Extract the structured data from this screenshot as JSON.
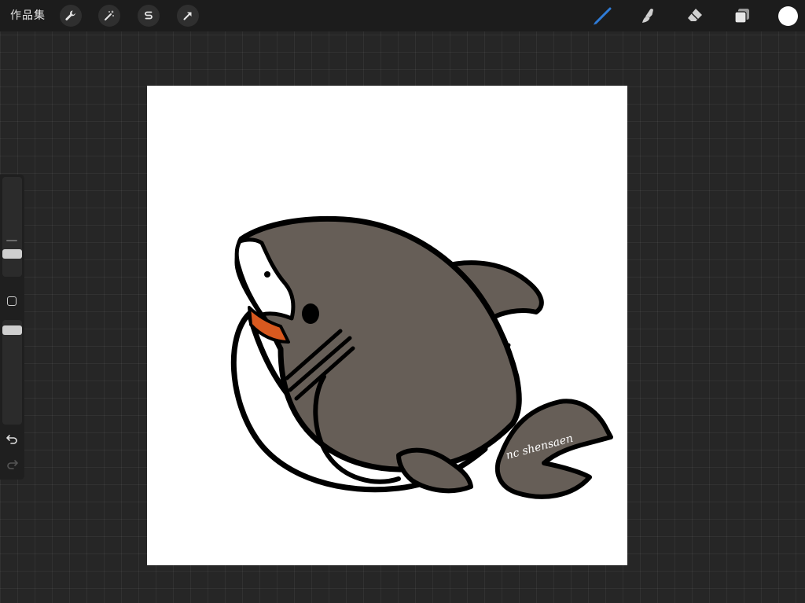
{
  "topbar": {
    "gallery_label": "作品集",
    "left_tools": [
      "wrench-icon",
      "magic-wand-icon",
      "selection-s-icon",
      "transform-arrow-icon"
    ],
    "right_tools": [
      "brush-icon",
      "smudge-icon",
      "eraser-icon",
      "layers-icon"
    ],
    "active_tool": "brush-icon",
    "active_color": "#ffffff",
    "accent_color": "#2f7bd6"
  },
  "sidebar": {
    "size_slider_level": 0.1,
    "opacity_slider_level": 0.1,
    "controls": [
      "modify-square-icon",
      "undo-icon",
      "redo-icon"
    ]
  },
  "canvas": {
    "artwork": "shark-illustration",
    "signature": "nc shensaen"
  }
}
